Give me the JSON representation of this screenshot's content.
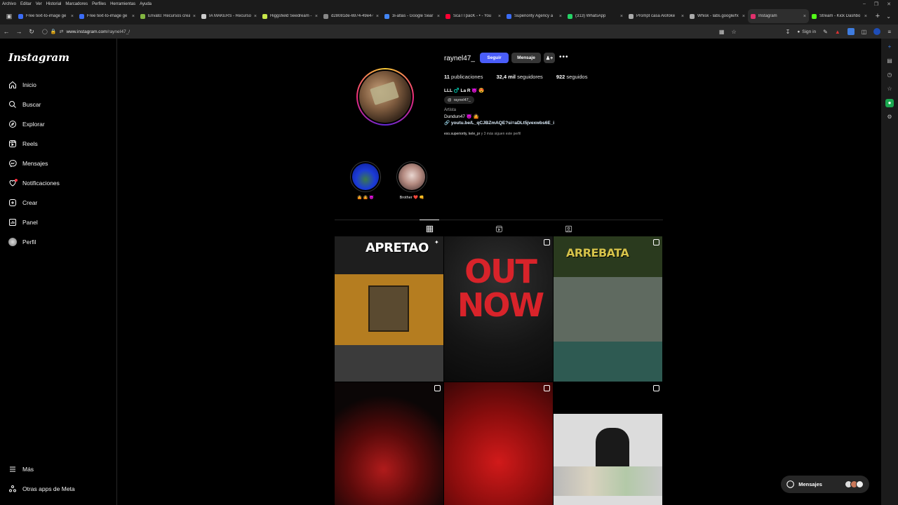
{
  "os_menu": [
    "Archivo",
    "Editar",
    "Ver",
    "Historial",
    "Marcadores",
    "Perfiles",
    "Herramientas",
    "Ayuda"
  ],
  "tabs": [
    {
      "label": "Free text-to-image ge",
      "color": "#3b6cf5",
      "active": false
    },
    {
      "label": "Free text-to-image ge",
      "color": "#3b6cf5",
      "active": false
    },
    {
      "label": "Envato: Recursos crea",
      "color": "#82b541",
      "active": false
    },
    {
      "label": "IA MAKERS - Recursos",
      "color": "#cccccc",
      "active": false
    },
    {
      "label": "Higgsfield Seedream -",
      "color": "#c8e84a",
      "active": false
    },
    {
      "label": "d28081de-6974-49e4-98",
      "color": "#888888",
      "active": false
    },
    {
      "label": "3i-atlas - Google Sear",
      "color": "#4285f4",
      "active": false
    },
    {
      "label": "ScaTTpacK - • - You",
      "color": "#ff0033",
      "active": false
    },
    {
      "label": "Superiority Agency a",
      "color": "#3b6cf5",
      "active": false
    },
    {
      "label": "(313) WhatsApp",
      "color": "#25d366",
      "active": false
    },
    {
      "label": "Prompt casa Alofoke",
      "color": "#aaaaaa",
      "active": false
    },
    {
      "label": "Whisk - labs.google/fx",
      "color": "#aaaaaa",
      "active": false
    },
    {
      "label": "Instagram",
      "color": "#e1306c",
      "active": true
    },
    {
      "label": "Stream - Kick Dashbo",
      "color": "#53fc18",
      "active": false
    }
  ],
  "address": {
    "url_host": "www.instagram.com",
    "url_path": "/rayneI47_/",
    "sign_in": "Sign in"
  },
  "sidebar": {
    "logo": "Instagram",
    "items": [
      {
        "label": "Inicio",
        "icon": "home-icon"
      },
      {
        "label": "Buscar",
        "icon": "search-icon"
      },
      {
        "label": "Explorar",
        "icon": "compass-icon"
      },
      {
        "label": "Reels",
        "icon": "reels-icon"
      },
      {
        "label": "Mensajes",
        "icon": "messenger-icon"
      },
      {
        "label": "Notificaciones",
        "icon": "heart-icon"
      },
      {
        "label": "Crear",
        "icon": "plus-icon"
      },
      {
        "label": "Panel",
        "icon": "dashboard-icon"
      },
      {
        "label": "Perfil",
        "icon": "profile-icon"
      }
    ],
    "more": "Más",
    "meta_apps": "Otras apps de Meta"
  },
  "profile": {
    "username": "raynel47_",
    "follow_label": "Seguir",
    "message_label": "Mensaje",
    "add_user_glyph": "+ᴿ",
    "more_glyph": "•••",
    "stats": {
      "posts_count": "11",
      "posts_label": "publicaciones",
      "followers_count": "32,4 mil",
      "followers_label": "seguidores",
      "following_count": "922",
      "following_label": "seguidos"
    },
    "bio_name": "LLL ♂️ La R 😈 😍",
    "threads_handle": "raynel47_",
    "category": "Artista",
    "bio_line": "Dundun47 😈 🤷",
    "link": "youtu.be/L_qCJBZmAQE?si=aDLt5jvexwbs6E_i",
    "followed_by_names": "exo.superiority, kele_pr",
    "followed_by_rest": "y 3 más siguen este perfil"
  },
  "highlights": [
    {
      "label": "🤷 🤷 😈"
    },
    {
      "label": "Brother ❤️ 👊"
    }
  ],
  "grid_text": {
    "post1_overlay": "APRETAO",
    "post2_overlay": "OUT NOW",
    "post3_overlay": "ARREBATA"
  },
  "messages_pill": {
    "label": "Mensajes"
  },
  "colors": {
    "accent": "#4a5df9",
    "background": "#000000",
    "secondary_button": "#363636"
  }
}
